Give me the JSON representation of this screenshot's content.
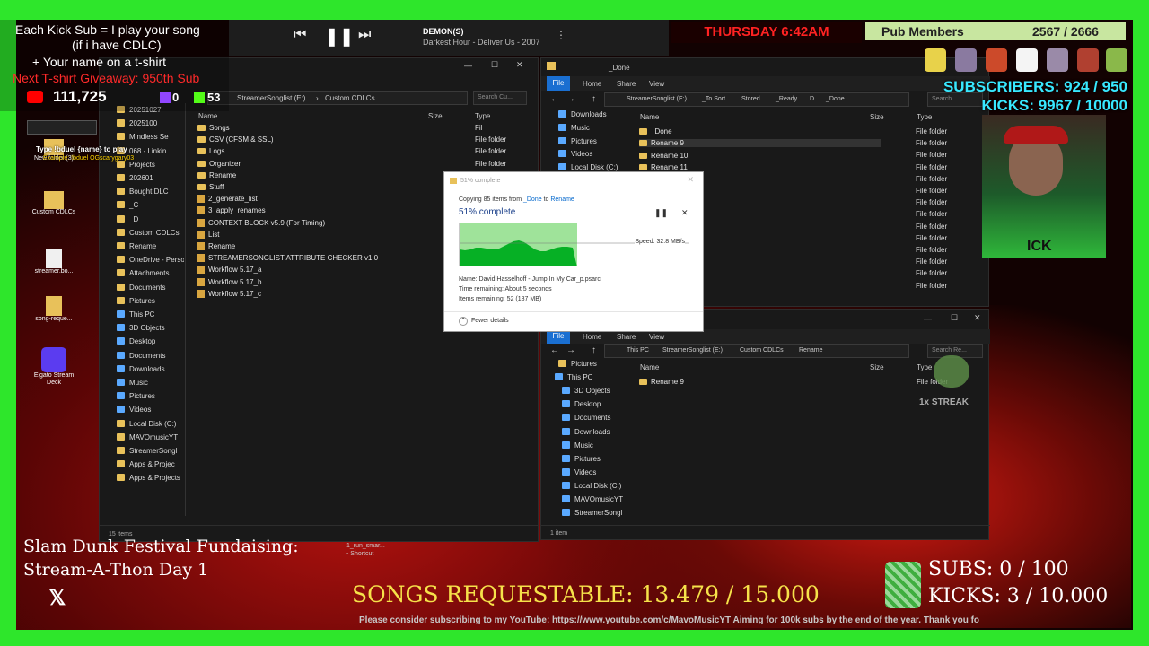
{
  "overlay": {
    "kick_sub_line1": "Each Kick Sub = I play your song",
    "kick_sub_line2": "(if i have CDLC)",
    "tshirt_line": "+ Your name on a t-shirt",
    "giveaway_line": "Next T-shirt Giveaway: 950th Sub",
    "yt_count": "111,725",
    "twitch_count": "0",
    "kick_count": "53",
    "day_time": "THURSDAY 6:42AM",
    "pub_members_label": "Pub Members",
    "pub_members_count": "2567 / 2666",
    "subscribers": "SUBSCRIBERS: 924 / 950",
    "kicks": "KICKS: 9967 / 10000",
    "fundraising_line1": "Slam Dunk Festival Fundaising:",
    "fundraising_line2": "Stream-A-Thon Day 1",
    "songs_requestable": "SONGS REQUESTABLE: 13.479 / 15.000",
    "subs_goal": "SUBS:  0 / 100",
    "kicks_goal": "KICKS: 3 / 10.000",
    "ticker": "Please consider subscribing to my YouTube: https://www.youtube.com/c/MavoMusicYT Aiming for 100k subs by the end of the year. Thank you fo",
    "streak": "1x STREAK",
    "chat_cmd": "Type !bduel {name} to play",
    "chat_example": "Example: !bduel OGscarygary03",
    "webcam_text": "ICK"
  },
  "player": {
    "artist": "DEMON(S)",
    "track": "Darkest Hour - Deliver Us - 2007"
  },
  "desktop": {
    "icons": [
      {
        "label": "New folder (3)"
      },
      {
        "label": "Custom CDLCs"
      },
      {
        "label": "streamer.bo..."
      },
      {
        "label": "song-reque..."
      },
      {
        "label": "Elgato Stream Deck"
      }
    ],
    "shortcut_label": "1_run_smar...",
    "shortcut_sub": "- Shortcut"
  },
  "left_explorer": {
    "breadcrumb": [
      "StreamerSonglist (E:)",
      "Custom CDLCs"
    ],
    "search_placeholder": "Search Cu...",
    "col_name": "Name",
    "col_size": "Size",
    "col_type": "Type",
    "nav": [
      "20251027",
      "2025100",
      "Mindless Se",
      "068 - Linkin",
      "Projects",
      "202601",
      "Bought DLC",
      "_C",
      "_D",
      "Custom CDLCs",
      "Rename",
      "OneDrive - Perso",
      "Attachments",
      "Documents",
      "Pictures",
      "This PC",
      "3D Objects",
      "Desktop",
      "Documents",
      "Downloads",
      "Music",
      "Pictures",
      "Videos",
      "Local Disk (C:)",
      "MAVOmusicYT",
      "StreamerSongl",
      "Apps & Projec",
      "Apps & Projects"
    ],
    "rows": [
      {
        "name": "Songs",
        "kind": "folder",
        "type": "Fil"
      },
      {
        "name": "CSV (CFSM & SSL)",
        "kind": "folder",
        "type": "File folder"
      },
      {
        "name": "Logs",
        "kind": "folder",
        "type": "File folder"
      },
      {
        "name": "Organizer",
        "kind": "folder",
        "type": "File folder"
      },
      {
        "name": "Rename",
        "kind": "folder",
        "type": ""
      },
      {
        "name": "Stuff",
        "kind": "folder",
        "type": ""
      },
      {
        "name": "2_generate_list",
        "kind": "file",
        "type": ""
      },
      {
        "name": "3_apply_renames",
        "kind": "file",
        "type": ""
      },
      {
        "name": "CONTEXT BLOCK v5.9 (For Timing)",
        "kind": "file",
        "type": ""
      },
      {
        "name": "List",
        "kind": "file",
        "type": ""
      },
      {
        "name": "Rename",
        "kind": "file",
        "type": ""
      },
      {
        "name": "STREAMERSONGLIST ATTRIBUTE CHECKER v1.0",
        "kind": "file",
        "type": ""
      },
      {
        "name": "Workflow 5.17_a",
        "kind": "file",
        "type": ""
      },
      {
        "name": "Workflow 5.17_b",
        "kind": "file",
        "type": ""
      },
      {
        "name": "Workflow 5.17_c",
        "kind": "file",
        "type": ""
      }
    ],
    "status": "15 items"
  },
  "right_top_explorer": {
    "title": "_Done",
    "ribbon": [
      "File",
      "Home",
      "Share",
      "View"
    ],
    "breadcrumb": [
      "StreamerSonglist (E:)",
      "_To Sort",
      "Stored",
      "_Ready",
      "D",
      "_Done"
    ],
    "search_placeholder": "Search",
    "col_name": "Name",
    "col_size": "Size",
    "col_type": "Type",
    "nav": [
      "Downloads",
      "Music",
      "Pictures",
      "Videos",
      "Local Disk (C:)"
    ],
    "rows": [
      {
        "name": "_Done",
        "type": "File folder"
      },
      {
        "name": "Rename 9",
        "type": "File folder"
      },
      {
        "name": "Rename 10",
        "type": "File folder"
      },
      {
        "name": "Rename 11",
        "type": "File folder"
      }
    ],
    "extra_types": [
      "File folder",
      "File folder",
      "File folder",
      "File folder",
      "File folder",
      "File folder",
      "File folder",
      "File folder",
      "File folder",
      "File folder",
      "File folder",
      "File folder",
      "File folder",
      "File folder"
    ]
  },
  "right_bottom_explorer": {
    "ribbon": [
      "File",
      "Home",
      "Share",
      "View"
    ],
    "breadcrumb": [
      "This PC",
      "StreamerSonglist (E:)",
      "Custom CDLCs",
      "Rename"
    ],
    "search_placeholder": "Search Re...",
    "col_name": "Name",
    "col_size": "Size",
    "col_type": "Type",
    "nav": [
      "Pictures",
      "This PC",
      "3D Objects",
      "Desktop",
      "Documents",
      "Downloads",
      "Music",
      "Pictures",
      "Videos",
      "Local Disk (C:)",
      "MAVOmusicYT",
      "StreamerSongl"
    ],
    "rows": [
      {
        "name": "Rename 9",
        "type": "File folder"
      }
    ],
    "status": "1 item"
  },
  "copy_dialog": {
    "title": "51% complete",
    "copying_prefix": "Copying 85 items from ",
    "from": "_Done",
    "to_word": " to ",
    "to": "Rename",
    "percent_label": "51% complete",
    "speed": "Speed: 32.8 MB/s",
    "name_line": "Name:  David Hasselhoff - Jump In My Car_p.psarc",
    "time_line": "Time remaining:  About 5 seconds",
    "items_line": "Items remaining:  52 (187 MB)",
    "fewer_details": "Fewer details",
    "progress": 0.51
  },
  "colors": {
    "green_screen": "#2ee62b",
    "progress_green": "#06b025",
    "folder": "#e8c15a",
    "accent_blue": "#0078d7"
  }
}
